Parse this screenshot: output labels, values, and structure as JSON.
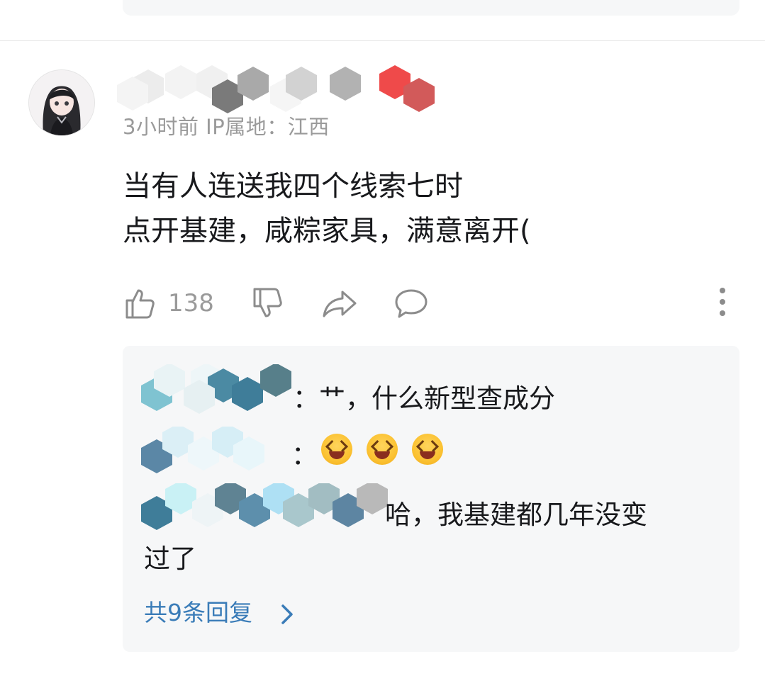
{
  "comment": {
    "meta": "3小时前  IP属地：江西",
    "lines": [
      "当有人连送我四个线索七时",
      "点开基建，咸粽家具，满意离开("
    ],
    "like_count": "138",
    "icons": [
      "thumbs-up-icon",
      "thumbs-down-icon",
      "share-icon",
      "reply-bubble-icon",
      "more-vertical-icon"
    ]
  },
  "replies": {
    "items": [
      {
        "text": "：艹，什么新型查成分"
      },
      {
        "text": "：",
        "emojis": [
          "laughing-emoji",
          "laughing-emoji",
          "laughing-emoji"
        ]
      },
      {
        "text": "哈，我基建都几年没变",
        "text_cont": "过了"
      }
    ],
    "more_label": "共9条回复",
    "link_color": "#3a7cb8"
  },
  "colors": {
    "text": "#18191c",
    "meta": "#9a9a9a",
    "reply_bg": "#f6f7f8"
  }
}
